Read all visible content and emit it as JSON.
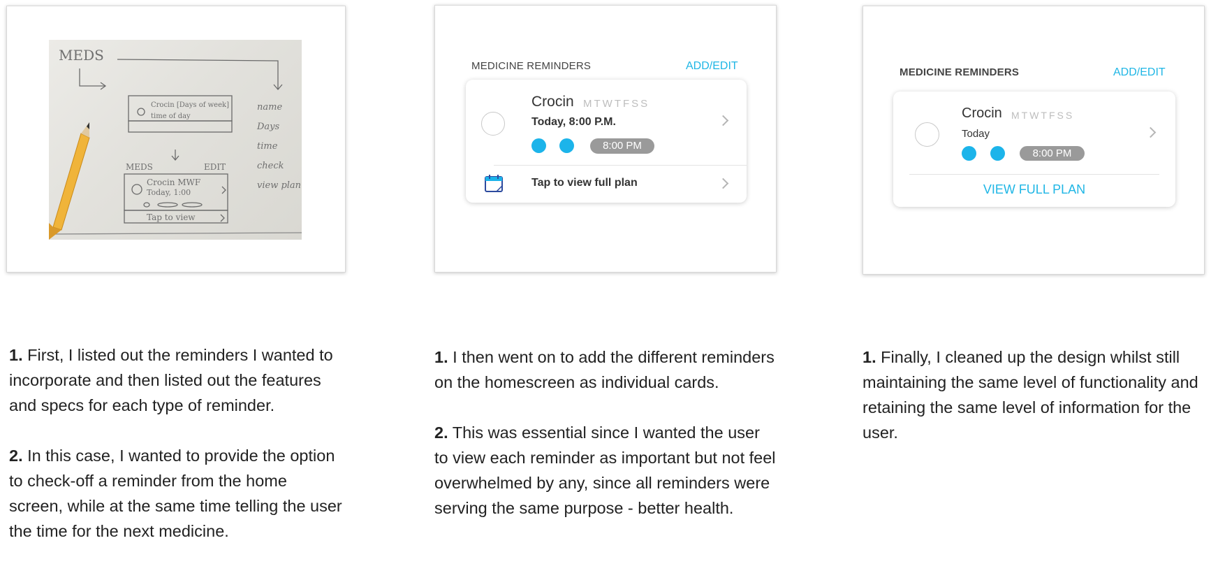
{
  "panels": [
    {
      "sketch": {
        "top_label": "MEDS",
        "card_text_1": "Crocin [Days of week]",
        "card_text_2": "time of day",
        "mid_label_left": "MEDS",
        "mid_label_right": "EDIT",
        "card2_text_1": "Crocin MWF",
        "card2_text_2": "Today, 1:00",
        "card2_footer": "Tap to view",
        "spec_list": [
          "name",
          "Days",
          "time",
          "check",
          "view plan"
        ]
      }
    },
    {
      "header": "MEDICINE REMINDERS",
      "add_edit": "ADD/EDIT",
      "med_name": "Crocin",
      "days": "MTWTFSS",
      "subtitle": "Today, 8:00 P.M.",
      "time_pill": "8:00 PM",
      "footer_link": "Tap to view full plan",
      "icons": [
        "check-circle-icon",
        "dose-dot-icon",
        "chevron-right-icon",
        "calendar-icon"
      ]
    },
    {
      "header": "MEDICINE REMINDERS",
      "add_edit": "ADD/EDIT",
      "med_name": "Crocin",
      "days": "MTWTFSS",
      "subtitle": "Today",
      "time_pill": "8:00 PM",
      "footer_link": "VIEW FULL PLAN"
    }
  ],
  "descriptions": [
    [
      {
        "num": "1.",
        "text": "First, I listed out the reminders I wanted to incorporate and then listed out the features and specs for each type of reminder."
      },
      {
        "num": "2.",
        "text": "In this case, I wanted to provide the option to check-off a reminder from the home screen, while at the same time telling the user the time for the next medicine."
      }
    ],
    [
      {
        "num": "1.",
        "text": "I then went on to add the different reminders on the homescreen as individual cards."
      },
      {
        "num": "2.",
        "text": "This was essential since I wanted the user to view each reminder as important but not feel overwhelmed by any, since all reminders were serving the same purpose - better health."
      }
    ],
    [
      {
        "num": "1.",
        "text": "Finally, I cleaned up the design whilst still maintaining the same level of functionality and retaining the same level of information for the user."
      }
    ]
  ],
  "colors": {
    "accent": "#1fb6e5",
    "dot": "#1cb4ea",
    "pill": "#9a9a9a",
    "calendar": "#2c4a9e"
  }
}
